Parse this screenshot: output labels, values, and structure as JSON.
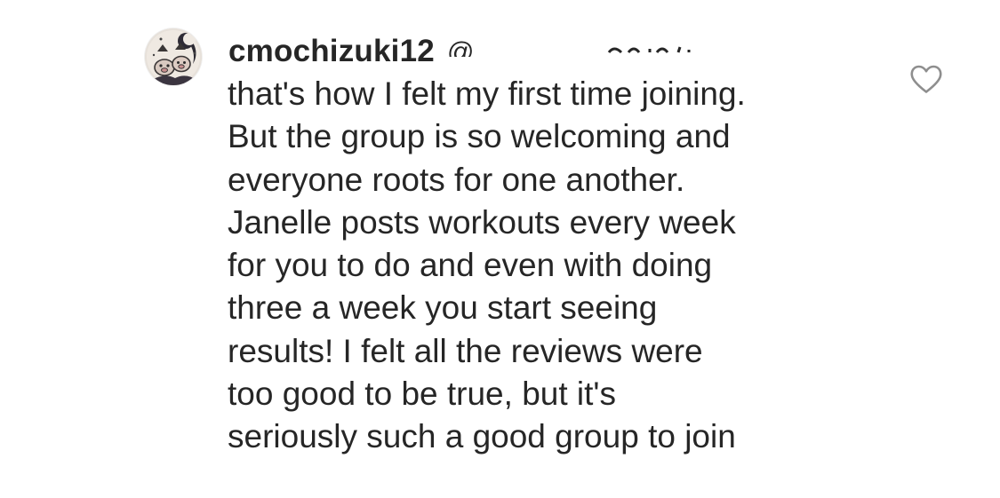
{
  "comment": {
    "username": "cmochizuki12",
    "mention_prefix": "@",
    "text": "that's how I felt my first time joining.\nBut the group is so welcoming and\neveryone roots for one another.\nJanelle posts workouts every week\nfor you to do and even with doing\nthree a week you start seeing\nresults! I felt all the reviews were\ntoo good to be true, but it's\nseriously such a good group to join"
  },
  "icons": {
    "avatar": "profile-avatar",
    "like": "heart-outline-icon"
  },
  "colors": {
    "text": "#262626",
    "icon_stroke": "#8e8e8e",
    "background": "#ffffff"
  }
}
